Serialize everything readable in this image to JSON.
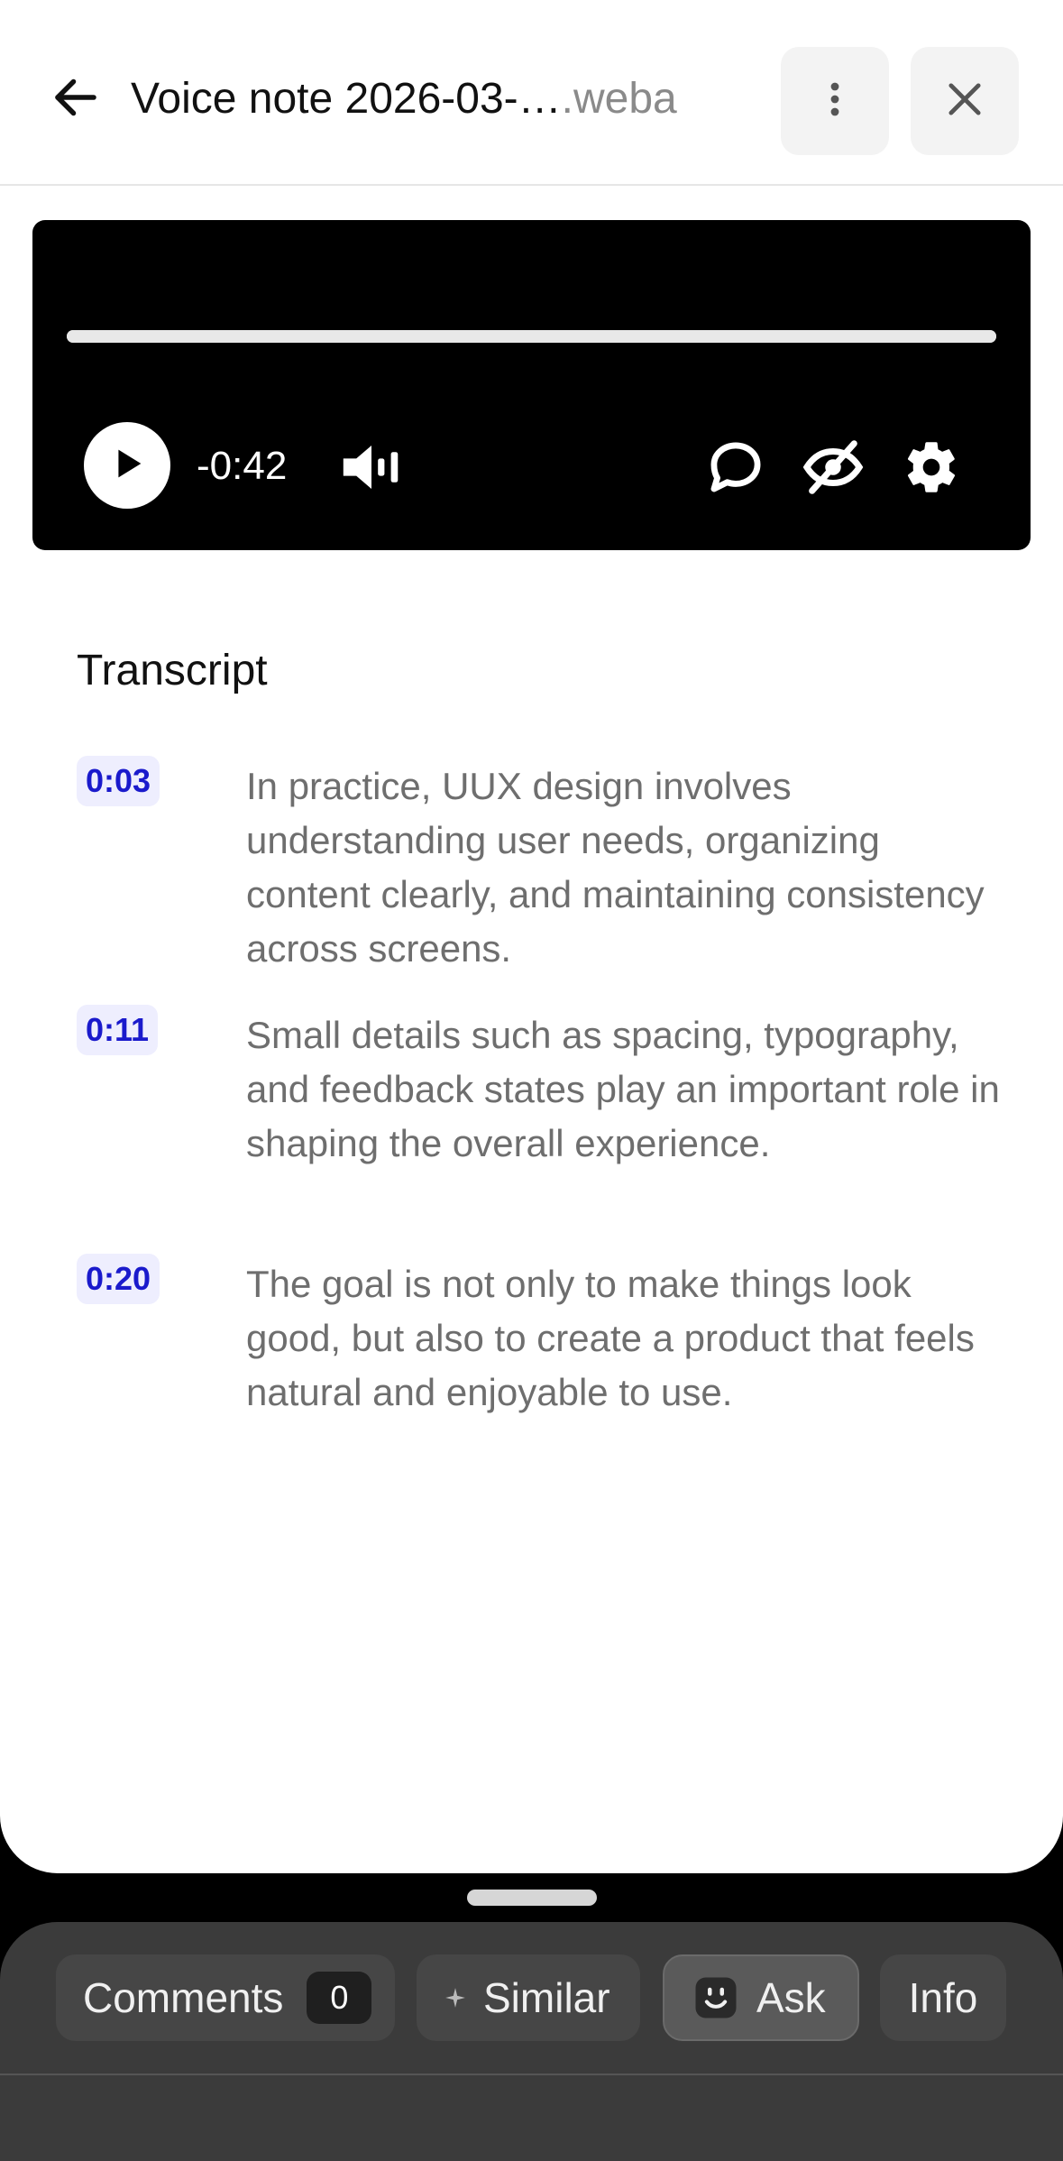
{
  "header": {
    "title": "Voice note 2026-03-…",
    "extension": ".weba",
    "back_icon": "arrow-left-icon",
    "more_icon": "more-vertical-icon",
    "close_icon": "close-icon"
  },
  "player": {
    "progress": 1.0,
    "time_remaining": "-0:42",
    "icons": [
      "play-icon",
      "volume-icon",
      "chat-bubble-icon",
      "eye-off-icon",
      "gear-icon"
    ]
  },
  "transcript": {
    "heading": "Transcript",
    "entries": [
      {
        "time": "0:03",
        "text": "In practice, UUX design involves understanding user needs, organizing content clearly, and maintaining consistency across screens."
      },
      {
        "time": "0:11",
        "text": "Small details such as spacing, typography, and feedback states play an important role in shaping the overall experience."
      },
      {
        "time": "0:20",
        "text": "The goal is not only to make things look good, but also to create a product that feels natural and enjoyable to use."
      }
    ]
  },
  "bottom_tabs": {
    "comments_label": "Comments",
    "comments_count": "0",
    "similar_label": "Similar",
    "ask_label": "Ask",
    "info_label": "Info"
  },
  "colors": {
    "timestamp_text": "#1a1acc",
    "timestamp_bg": "#eeeefe",
    "bottom_bar": "#3b3b3b"
  }
}
